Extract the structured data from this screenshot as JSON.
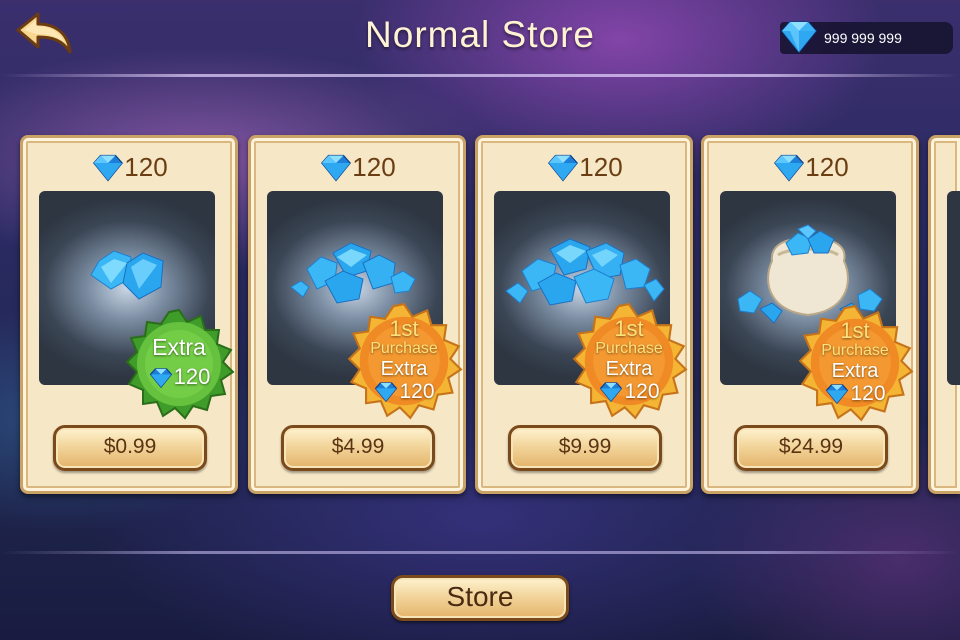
{
  "header": {
    "title": "Normal Store",
    "back_icon": "back-arrow-icon",
    "currency": {
      "icon": "diamond-icon",
      "amount": "999 999 999"
    }
  },
  "colors": {
    "card_bg": "#f6e7c7",
    "card_border": "#c9a266",
    "price_text": "#6a3e12",
    "badge_green": "#56b33a",
    "badge_orange": "#f08a25",
    "gem_blue": "#2fa8f2"
  },
  "products": [
    {
      "gems": "120",
      "price": "$0.99",
      "badge": {
        "type": "green",
        "line1": "Extra",
        "bonus": "120"
      }
    },
    {
      "gems": "120",
      "price": "$4.99",
      "badge": {
        "type": "orange",
        "line0": "1st",
        "line_purchase": "Purchase",
        "line1": "Extra",
        "bonus": "120"
      }
    },
    {
      "gems": "120",
      "price": "$9.99",
      "badge": {
        "type": "orange",
        "line0": "1st",
        "line_purchase": "Purchase",
        "line1": "Extra",
        "bonus": "120"
      }
    },
    {
      "gems": "120",
      "price": "$24.99",
      "badge": {
        "type": "orange",
        "line0": "1st",
        "line_purchase": "Purchase",
        "line1": "Extra",
        "bonus": "120"
      }
    }
  ],
  "footer": {
    "store_label": "Store"
  }
}
